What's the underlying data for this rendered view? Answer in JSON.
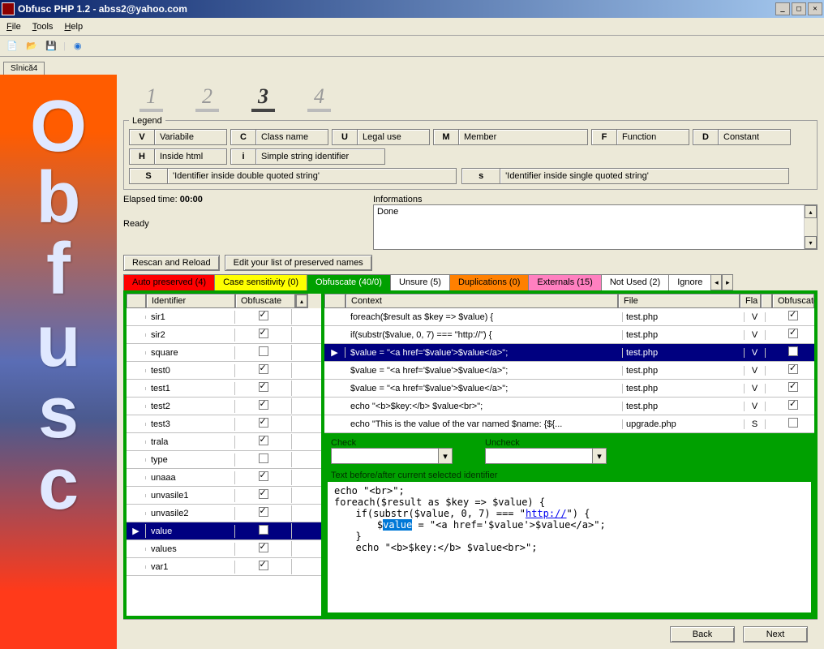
{
  "window": {
    "title": "Obfusc PHP 1.2 - abss2@yahoo.com"
  },
  "menu": {
    "file": "File",
    "tools": "Tools",
    "help": "Help"
  },
  "doctab": "Sînică4",
  "steps": [
    "1",
    "2",
    "3",
    "4"
  ],
  "active_step": 2,
  "legend": {
    "title": "Legend",
    "items": [
      {
        "c": "V",
        "d": "Variabile"
      },
      {
        "c": "C",
        "d": "Class name"
      },
      {
        "c": "U",
        "d": "Legal use"
      },
      {
        "c": "M",
        "d": "Member"
      },
      {
        "c": "F",
        "d": "Function"
      },
      {
        "c": "D",
        "d": "Constant"
      },
      {
        "c": "H",
        "d": "Inside html"
      },
      {
        "c": "i",
        "d": "Simple string identifier"
      }
    ],
    "str_upper": {
      "c": "S",
      "d": "'Identifier inside double quoted string'"
    },
    "str_lower": {
      "c": "s",
      "d": "'Identifier inside single quoted string'"
    }
  },
  "elapsed": {
    "label": "Elapsed time:",
    "value": "00:00",
    "status": "Ready"
  },
  "info": {
    "label": "Informations",
    "text": "Done"
  },
  "buttons": {
    "rescan": "Rescan and  Reload",
    "edit": "Edit your list of preserved names",
    "back": "Back",
    "next": "Next"
  },
  "tabs": [
    {
      "label": "Auto preserved (4)",
      "cls": "red"
    },
    {
      "label": "Case sensitivity (0)",
      "cls": "yellow"
    },
    {
      "label": "Obfuscate (40/0)",
      "cls": "green"
    },
    {
      "label": "Unsure (5)",
      "cls": "white"
    },
    {
      "label": "Duplications (0)",
      "cls": "orange"
    },
    {
      "label": "Externals (15)",
      "cls": "pink"
    },
    {
      "label": "Not Used (2)",
      "cls": "white"
    },
    {
      "label": "Ignore",
      "cls": "white"
    }
  ],
  "ident_header": {
    "id": "Identifier",
    "obf": "Obfuscate"
  },
  "identifiers": [
    {
      "name": "sir1",
      "obf": true
    },
    {
      "name": "sir2",
      "obf": true
    },
    {
      "name": "square",
      "obf": false
    },
    {
      "name": "test0",
      "obf": true
    },
    {
      "name": "test1",
      "obf": true
    },
    {
      "name": "test2",
      "obf": true
    },
    {
      "name": "test3",
      "obf": true
    },
    {
      "name": "trala",
      "obf": true
    },
    {
      "name": "type",
      "obf": false
    },
    {
      "name": "unaaa",
      "obf": true
    },
    {
      "name": "unvasile1",
      "obf": true
    },
    {
      "name": "unvasile2",
      "obf": true
    },
    {
      "name": "value",
      "obf": false,
      "sel": true
    },
    {
      "name": "values",
      "obf": true
    },
    {
      "name": "var1",
      "obf": true
    }
  ],
  "ctx_header": {
    "ctx": "Context",
    "file": "File",
    "flag": "Fla",
    "obf": "Obfuscate"
  },
  "contexts": [
    {
      "txt": "foreach($result as $key => $value) {",
      "file": "test.php",
      "flag": "V",
      "obf": true
    },
    {
      "txt": "if(substr($value, 0, 7) === \"http://\") {",
      "file": "test.php",
      "flag": "V",
      "obf": true
    },
    {
      "txt": "$value = \"<a href='$value'>$value</a>\";",
      "file": "test.php",
      "flag": "V",
      "obf": true,
      "sel": true
    },
    {
      "txt": "$value = \"<a href='$value'>$value</a>\";",
      "file": "test.php",
      "flag": "V",
      "obf": true
    },
    {
      "txt": "$value = \"<a href='$value'>$value</a>\";",
      "file": "test.php",
      "flag": "V",
      "obf": true
    },
    {
      "txt": "echo \"<b>$key:</b> $value<br>\";",
      "file": "test.php",
      "flag": "V",
      "obf": true
    },
    {
      "txt": "echo \"This is the value of the var named $name: {${...",
      "file": "upgrade.php",
      "flag": "S",
      "obf": false
    }
  ],
  "check": {
    "check": "Check",
    "uncheck": "Uncheck"
  },
  "src": {
    "label": "Text before/after current selected identifier",
    "lines": [
      "echo \"<br>\";",
      "foreach($result as $key => $value) {",
      "  if(substr($value, 0, 7) === \"http://\") {",
      "    $value = \"<a href='$value'>$value</a>\";",
      "  }",
      "  echo \"<b>$key:</b> $value<br>\";"
    ],
    "hl_line": 3,
    "hl_word": "value"
  },
  "sidebar_word": "Obfusc"
}
